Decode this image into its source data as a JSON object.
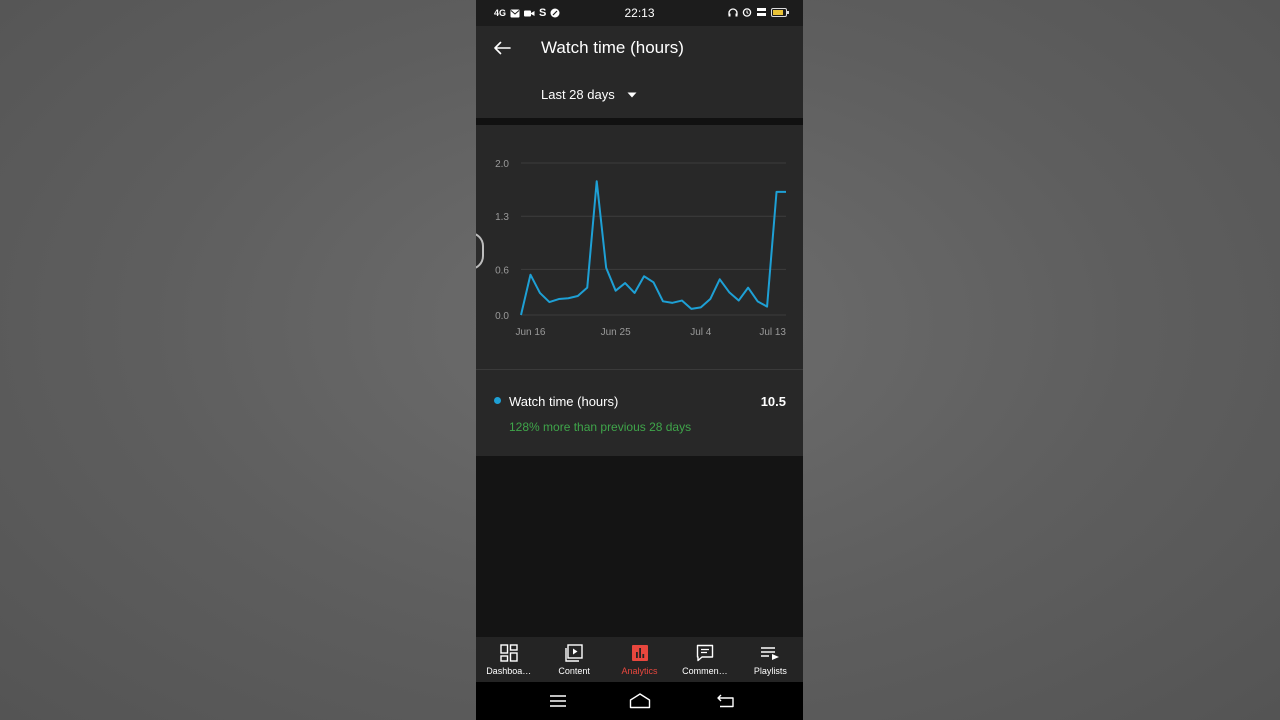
{
  "status_bar": {
    "network": "4G",
    "carrier_letter": "S",
    "time": "22:13",
    "icons": [
      "mail-icon",
      "video-icon",
      "app-icon",
      "headphones-icon",
      "alarm-icon",
      "volte-icon",
      "battery-icon"
    ]
  },
  "header": {
    "title": "Watch time (hours)",
    "period": "Last 28 days",
    "back_icon": "arrow-left-icon",
    "dropdown_icon": "caret-down-icon"
  },
  "chart_data": {
    "type": "line",
    "x": [
      1,
      2,
      3,
      4,
      5,
      6,
      7,
      8,
      9,
      10,
      11,
      12,
      13,
      14,
      15,
      16,
      17,
      18,
      19,
      20,
      21,
      22,
      23,
      24,
      25,
      26,
      27,
      28,
      29
    ],
    "xtick_positions": [
      2,
      11,
      20,
      29
    ],
    "xtick_labels": [
      "Jun 16",
      "Jun 25",
      "Jul 4",
      "Jul 13"
    ],
    "yticks": [
      0.0,
      0.6,
      1.3,
      2.0
    ],
    "ytick_labels": [
      "0.0",
      "0.6",
      "1.3",
      "2.0"
    ],
    "ylim": [
      0,
      2.0
    ],
    "grid": true,
    "series": [
      {
        "color": "#1ea0d5",
        "values": [
          0.0,
          0.53,
          0.29,
          0.17,
          0.21,
          0.22,
          0.25,
          0.36,
          1.76,
          0.62,
          0.32,
          0.42,
          0.29,
          0.51,
          0.43,
          0.18,
          0.16,
          0.19,
          0.08,
          0.1,
          0.21,
          0.47,
          0.3,
          0.19,
          0.36,
          0.18,
          0.11,
          1.62,
          1.62
        ]
      }
    ]
  },
  "metric": {
    "label": "Watch time (hours)",
    "value": "10.5",
    "change": "128% more than previous 28 days",
    "dot_color": "#1ea0d5",
    "change_color": "#3fa54a"
  },
  "nav": {
    "active_color": "#e8473e",
    "items": [
      {
        "label": "Dashboa…",
        "icon": "dashboard-icon"
      },
      {
        "label": "Content",
        "icon": "content-icon"
      },
      {
        "label": "Analytics",
        "icon": "analytics-icon"
      },
      {
        "label": "Commen…",
        "icon": "comments-icon"
      },
      {
        "label": "Playlists",
        "icon": "playlists-icon"
      }
    ]
  }
}
